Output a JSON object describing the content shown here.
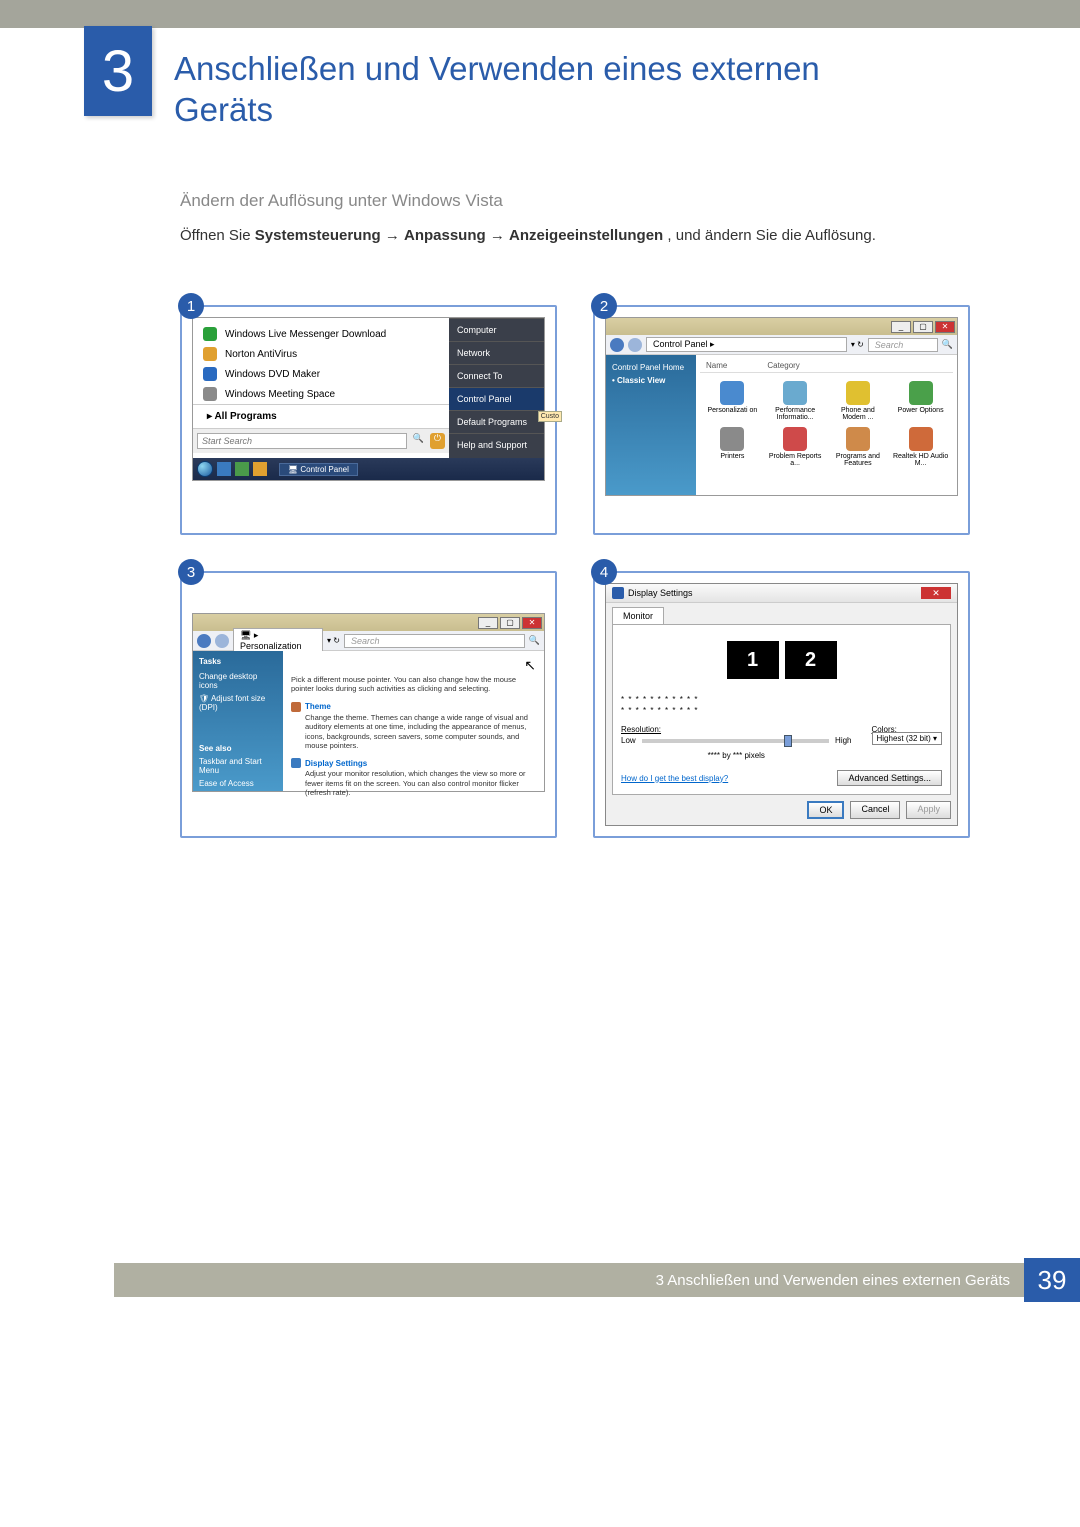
{
  "chapter": {
    "number": "3",
    "title": "Anschließen und Verwenden eines externen Geräts"
  },
  "section": {
    "subtitle": "Ändern der Auflösung unter Windows Vista",
    "instruction_pre": "Öffnen Sie ",
    "path1": "Systemsteuerung",
    "arrow": " → ",
    "path2": "Anpassung",
    "path3": "Anzeigeeinstellungen",
    "instruction_post": ", und ändern Sie die Auflösung."
  },
  "panel_nums": {
    "one": "1",
    "two": "2",
    "three": "3",
    "four": "4"
  },
  "panel1": {
    "left_items": [
      "Windows Live Messenger Download",
      "Norton AntiVirus",
      "Windows DVD Maker",
      "Windows Meeting Space"
    ],
    "all_programs": "All Programs",
    "search_placeholder": "Start Search",
    "right_items": [
      "Computer",
      "Network",
      "Connect To",
      "Control Panel",
      "Default Programs",
      "Help and Support"
    ],
    "right_highlight": "Control Panel",
    "custo_hint": "Custo",
    "taskbar_label": "Control Panel"
  },
  "panel2": {
    "path": "Control Panel ▸",
    "search": "Search",
    "side": {
      "home": "Control Panel Home",
      "classic": "Classic View"
    },
    "columns": {
      "name": "Name",
      "category": "Category"
    },
    "icons": [
      "Personalizati on",
      "Performance Informatio...",
      "Phone and Modem ...",
      "Power Options",
      "Printers",
      "Problem Reports a...",
      "Programs and Features",
      "Realtek HD Audio M..."
    ]
  },
  "panel3": {
    "path": "Personalization",
    "side": {
      "tasks": "Tasks",
      "icons": "Change desktop icons",
      "dpi": "Adjust font size (DPI)",
      "seealso": "See also",
      "taskbar": "Taskbar and Start Menu",
      "ease": "Ease of Access"
    },
    "blocks": [
      {
        "icon": "#7aa0c0",
        "title": "",
        "desc": "Pick a different mouse pointer. You can also change how the mouse pointer looks during such activities as clicking and selecting."
      },
      {
        "icon": "#c06a3a",
        "title": "Theme",
        "desc": "Change the theme. Themes can change a wide range of visual and auditory elements at one time, including the appearance of menus, icons, backgrounds, screen savers, some computer sounds, and mouse pointers."
      },
      {
        "icon": "#3a7ac0",
        "title": "Display Settings",
        "desc": "Adjust your monitor resolution, which changes the view so more or fewer items fit on the screen. You can also control monitor flicker (refresh rate)."
      }
    ]
  },
  "panel4": {
    "title": "Display Settings",
    "tab": "Monitor",
    "mon1": "1",
    "mon2": "2",
    "stars": "* * * * * * * * * * *",
    "resolution": "Resolution:",
    "low": "Low",
    "high": "High",
    "pixels": "**** by *** pixels",
    "colors": "Colors:",
    "color_val": "Highest (32 bit)",
    "help": "How do I get the best display?",
    "advanced": "Advanced Settings...",
    "ok": "OK",
    "cancel": "Cancel",
    "apply": "Apply"
  },
  "footer": {
    "text": "3 Anschließen und Verwenden eines externen Geräts",
    "page": "39"
  },
  "icon_colors": [
    "#2aa03a",
    "#e0a030",
    "#2a6ac0",
    "#8a8a8a"
  ]
}
